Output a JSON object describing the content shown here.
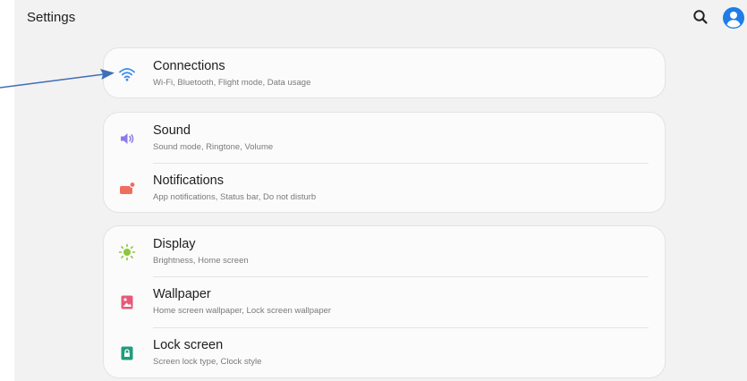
{
  "header": {
    "title": "Settings",
    "search_icon": "search-icon",
    "account_icon": "account-icon"
  },
  "accent": "#1f7ce8",
  "groups": [
    {
      "items": [
        {
          "label": "Connections",
          "subtitle": "Wi-Fi, Bluetooth, Flight mode, Data usage",
          "icon": "wifi-icon",
          "icon_color": "#3a8bea"
        }
      ]
    },
    {
      "items": [
        {
          "label": "Sound",
          "subtitle": "Sound mode, Ringtone, Volume",
          "icon": "speaker-icon",
          "icon_color": "#8a7be6"
        },
        {
          "label": "Notifications",
          "subtitle": "App notifications, Status bar, Do not disturb",
          "icon": "notification-icon",
          "icon_color": "#ef6e5e"
        }
      ]
    },
    {
      "items": [
        {
          "label": "Display",
          "subtitle": "Brightness, Home screen",
          "icon": "sun-icon",
          "icon_color": "#8cc63f"
        },
        {
          "label": "Wallpaper",
          "subtitle": "Home screen wallpaper, Lock screen wallpaper",
          "icon": "wallpaper-icon",
          "icon_color": "#e8587a"
        },
        {
          "label": "Lock screen",
          "subtitle": "Screen lock type, Clock style",
          "icon": "lock-icon",
          "icon_color": "#1f9c7e"
        }
      ]
    }
  ],
  "annotation": {
    "type": "arrow",
    "target": "Connections",
    "color": "#3f6fb5"
  }
}
